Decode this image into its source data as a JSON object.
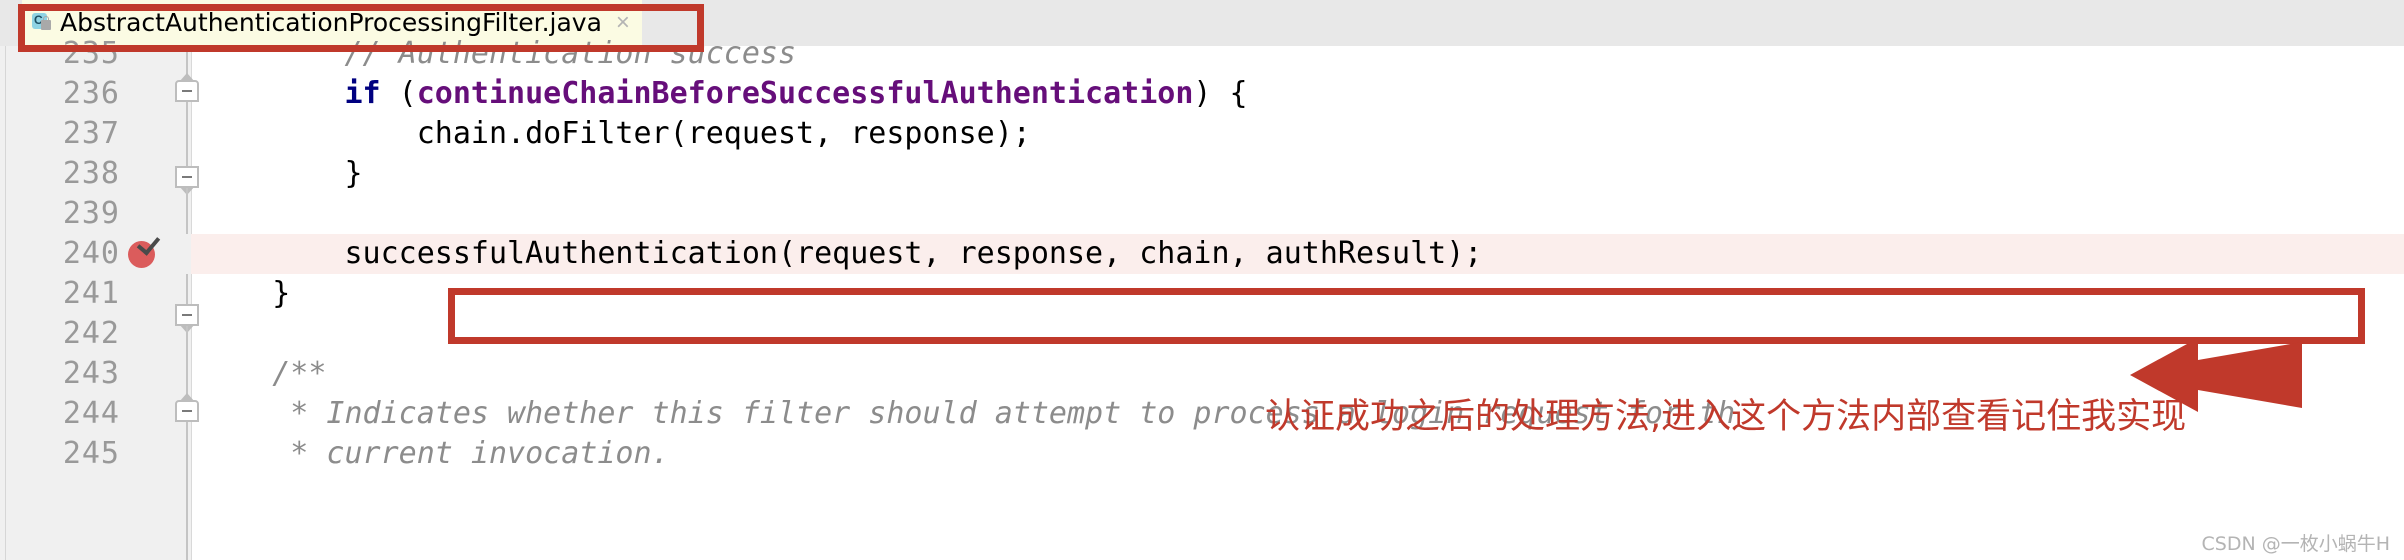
{
  "editor": {
    "tab": {
      "icon": "java-class-locked-icon",
      "title": "AbstractAuthenticationProcessingFilter.java",
      "close_label": "×"
    },
    "highlighted_line": 240,
    "breakpoint_line": 240,
    "lines": [
      {
        "number": "235",
        "segments": [
          {
            "text": "        // Authentication success",
            "style": "comment"
          }
        ]
      },
      {
        "number": "236",
        "segments": [
          {
            "text": "        ",
            "style": "plain"
          },
          {
            "text": "if",
            "style": "kw"
          },
          {
            "text": " (",
            "style": "plain"
          },
          {
            "text": "continueChainBeforeSuccessfulAuthentication",
            "style": "field"
          },
          {
            "text": ") {",
            "style": "plain"
          }
        ]
      },
      {
        "number": "237",
        "segments": [
          {
            "text": "            chain.doFilter(request, response);",
            "style": "plain"
          }
        ]
      },
      {
        "number": "238",
        "segments": [
          {
            "text": "        }",
            "style": "plain"
          }
        ]
      },
      {
        "number": "239",
        "segments": [
          {
            "text": "",
            "style": "plain"
          }
        ]
      },
      {
        "number": "240",
        "segments": [
          {
            "text": "        successfulAuthentication(request, response, chain, authResult);",
            "style": "plain"
          }
        ]
      },
      {
        "number": "241",
        "segments": [
          {
            "text": "    }",
            "style": "plain"
          }
        ]
      },
      {
        "number": "242",
        "segments": [
          {
            "text": "",
            "style": "plain"
          }
        ]
      },
      {
        "number": "243",
        "segments": [
          {
            "text": "    /**",
            "style": "doc"
          }
        ]
      },
      {
        "number": "244",
        "segments": [
          {
            "text": "     * Indicates whether this filter should attempt to process a login request for th",
            "style": "doc"
          }
        ]
      },
      {
        "number": "245",
        "segments": [
          {
            "text": "     * current invocation.",
            "style": "doc"
          }
        ]
      }
    ]
  },
  "annotation": {
    "text": "认证成功之后的处理方法,进入这个方法内部查看记住我实现",
    "color": "#c0392b",
    "boxes": [
      "tab-highlight-box",
      "code-line-highlight-box"
    ],
    "arrow": "left-pointing-arrow"
  },
  "watermark": {
    "text": "CSDN @一枚小蜗牛H"
  },
  "colors": {
    "annotation_red": "#c0392b",
    "keyword_blue": "#000080",
    "field_purple": "#660e7a",
    "comment_gray": "#8c8c8c",
    "tab_background": "#fbfbe3",
    "highlight_row": "#fbeeec",
    "gutter": "#f0f0f0"
  }
}
